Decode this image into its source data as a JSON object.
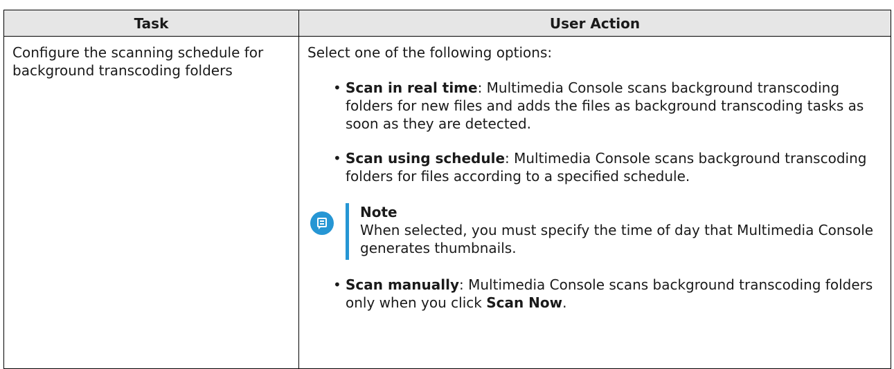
{
  "table": {
    "headers": {
      "task": "Task",
      "action": "User Action"
    },
    "row": {
      "task": "Configure the scanning schedule for background transcoding folders",
      "intro": "Select one of the following options:",
      "options": [
        {
          "bullet": "•",
          "title": "Scan in real time",
          "text": ": Multimedia Console scans background transcoding folders for new files and adds the files as background transcoding tasks as soon as they are detected."
        },
        {
          "bullet": "•",
          "title": "Scan using schedule",
          "text": ": Multimedia Console scans background transcoding folders for files according to a specified schedule."
        },
        {
          "bullet": "•",
          "title": "Scan manually",
          "text": ": Multimedia Console scans background transcoding folders only when you click ",
          "button_ref": "Scan Now",
          "end": "."
        }
      ],
      "note": {
        "icon": "note-icon",
        "title": "Note",
        "text": "When selected, you must specify the time of day that Multimedia Console generates thumbnails."
      }
    }
  },
  "colors": {
    "header_bg": "#e6e6e6",
    "note_accent": "#2696d4",
    "border": "#000000"
  }
}
